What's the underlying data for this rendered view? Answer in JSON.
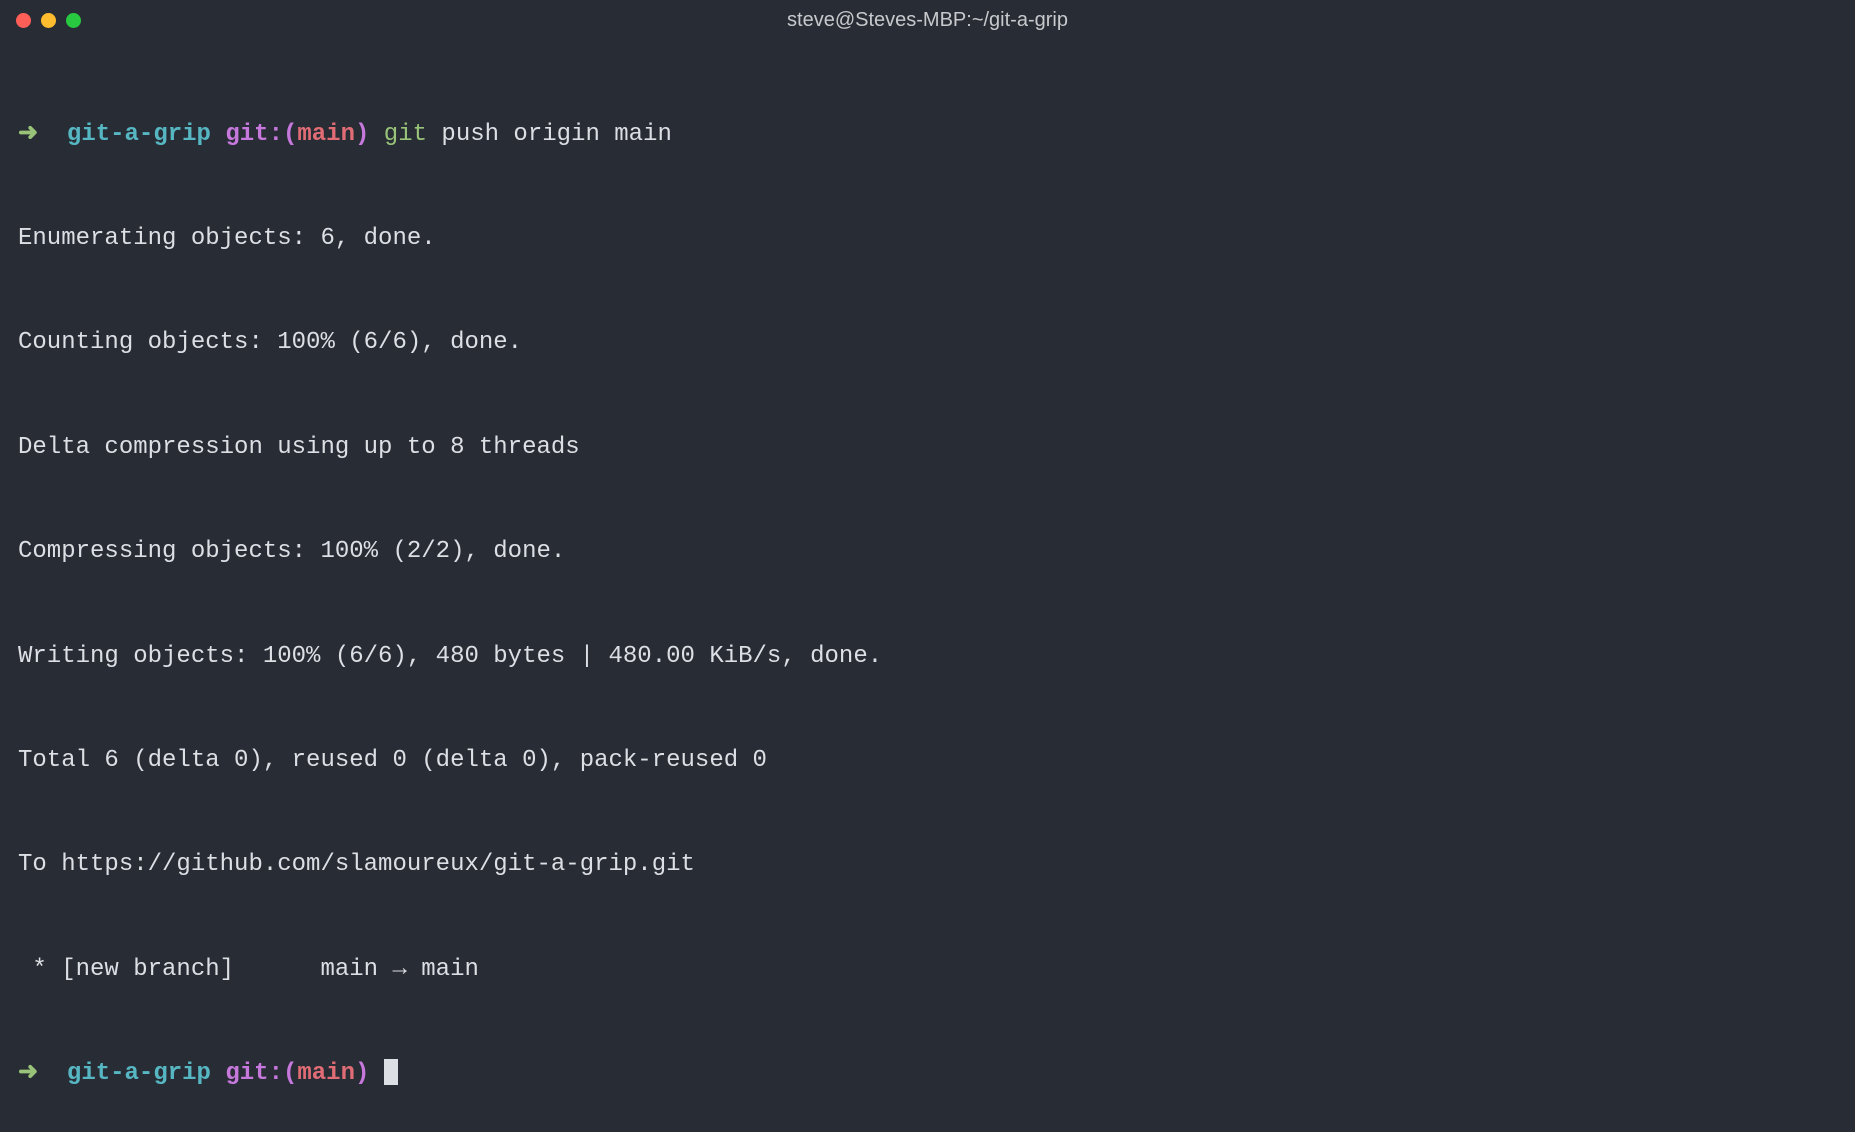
{
  "window": {
    "title": "steve@Steves-MBP:~/git-a-grip"
  },
  "prompt1": {
    "arrow": "➜",
    "dir": "git-a-grip",
    "git_label": "git:",
    "paren_open": "(",
    "branch": "main",
    "paren_close": ")",
    "cmd_git": "git",
    "cmd_rest": " push origin main"
  },
  "output": {
    "l1": "Enumerating objects: 6, done.",
    "l2": "Counting objects: 100% (6/6), done.",
    "l3": "Delta compression using up to 8 threads",
    "l4": "Compressing objects: 100% (2/2), done.",
    "l5": "Writing objects: 100% (6/6), 480 bytes | 480.00 KiB/s, done.",
    "l6": "Total 6 (delta 0), reused 0 (delta 0), pack-reused 0",
    "l7": "To https://github.com/slamoureux/git-a-grip.git",
    "l8": " * [new branch]      main → main"
  },
  "prompt2": {
    "arrow": "➜",
    "dir": "git-a-grip",
    "git_label": "git:",
    "paren_open": "(",
    "branch": "main",
    "paren_close": ")"
  }
}
